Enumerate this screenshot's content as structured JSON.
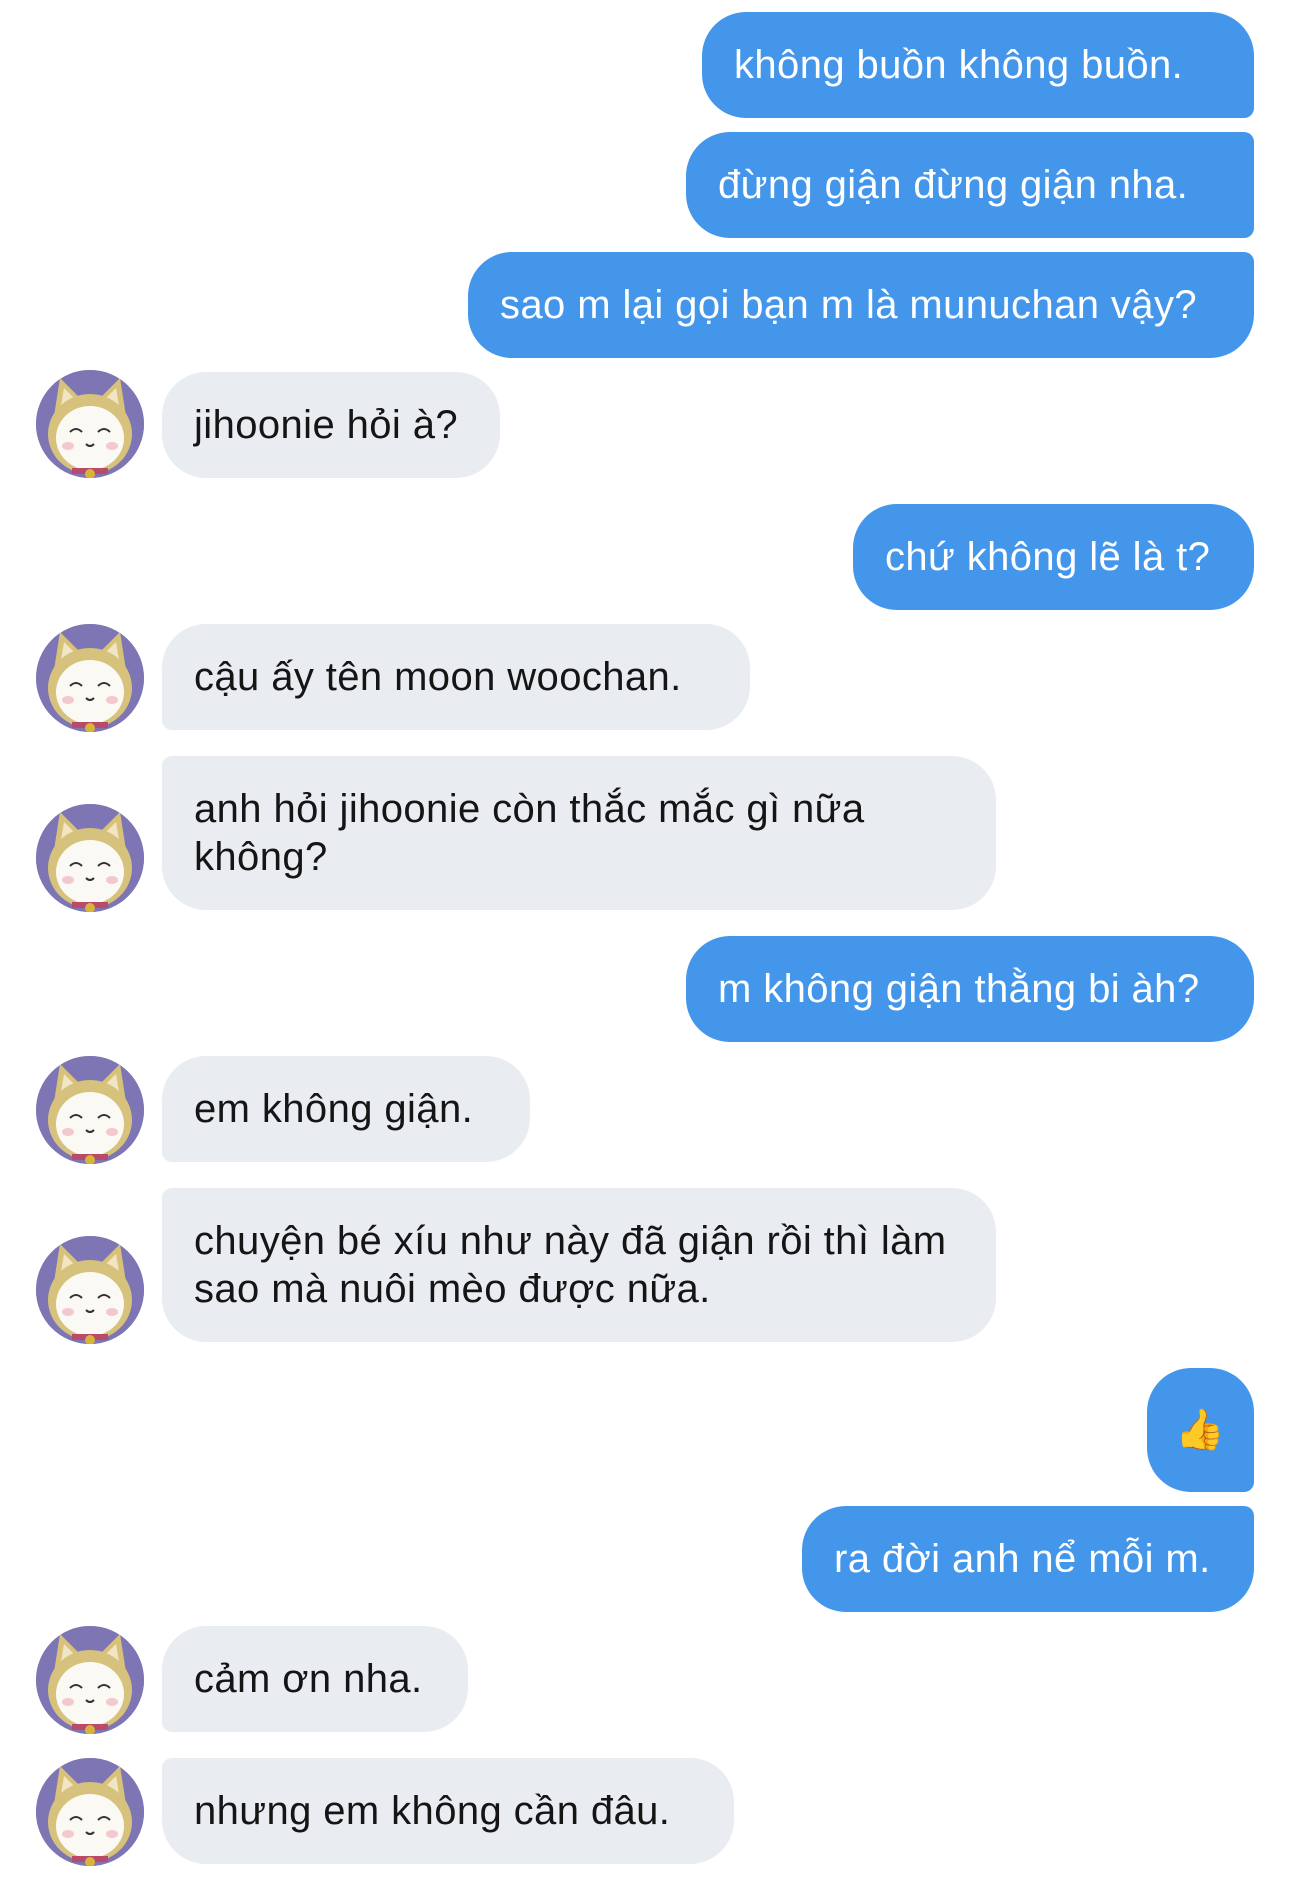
{
  "messages": [
    {
      "side": "out",
      "text": "không buồn không buồn."
    },
    {
      "side": "out",
      "text": "đừng giận đừng giận nha."
    },
    {
      "side": "out",
      "text": "sao m lại gọi bạn m là munuchan vậy?"
    },
    {
      "side": "in",
      "text": "jihoonie hỏi à?"
    },
    {
      "side": "out",
      "text": "chứ không lẽ là t?"
    },
    {
      "side": "in",
      "text": "cậu ấy tên moon woochan."
    },
    {
      "side": "in",
      "text": "anh hỏi jihoonie còn thắc mắc gì nữa không?"
    },
    {
      "side": "out",
      "text": "m không giận thằng bi àh?"
    },
    {
      "side": "in",
      "text": "em không giận."
    },
    {
      "side": "in",
      "text": "chuyện bé xíu như này đã giận rồi thì làm sao mà nuôi mèo được nữa."
    },
    {
      "side": "out",
      "text": "👍",
      "icon": "thumbs-up-icon"
    },
    {
      "side": "out",
      "text": "ra đời anh nể mỗi m."
    },
    {
      "side": "in",
      "text": "cảm ơn nha."
    },
    {
      "side": "in",
      "text": "nhưng em không cần đâu."
    }
  ],
  "colors": {
    "outgoing_bubble": "#4396ea",
    "outgoing_text": "#ffffff",
    "incoming_bubble": "#e9ecf0",
    "incoming_text": "#151515",
    "avatar_background": "#7e76b4"
  },
  "avatar": {
    "icon": "cat-avatar-icon"
  }
}
